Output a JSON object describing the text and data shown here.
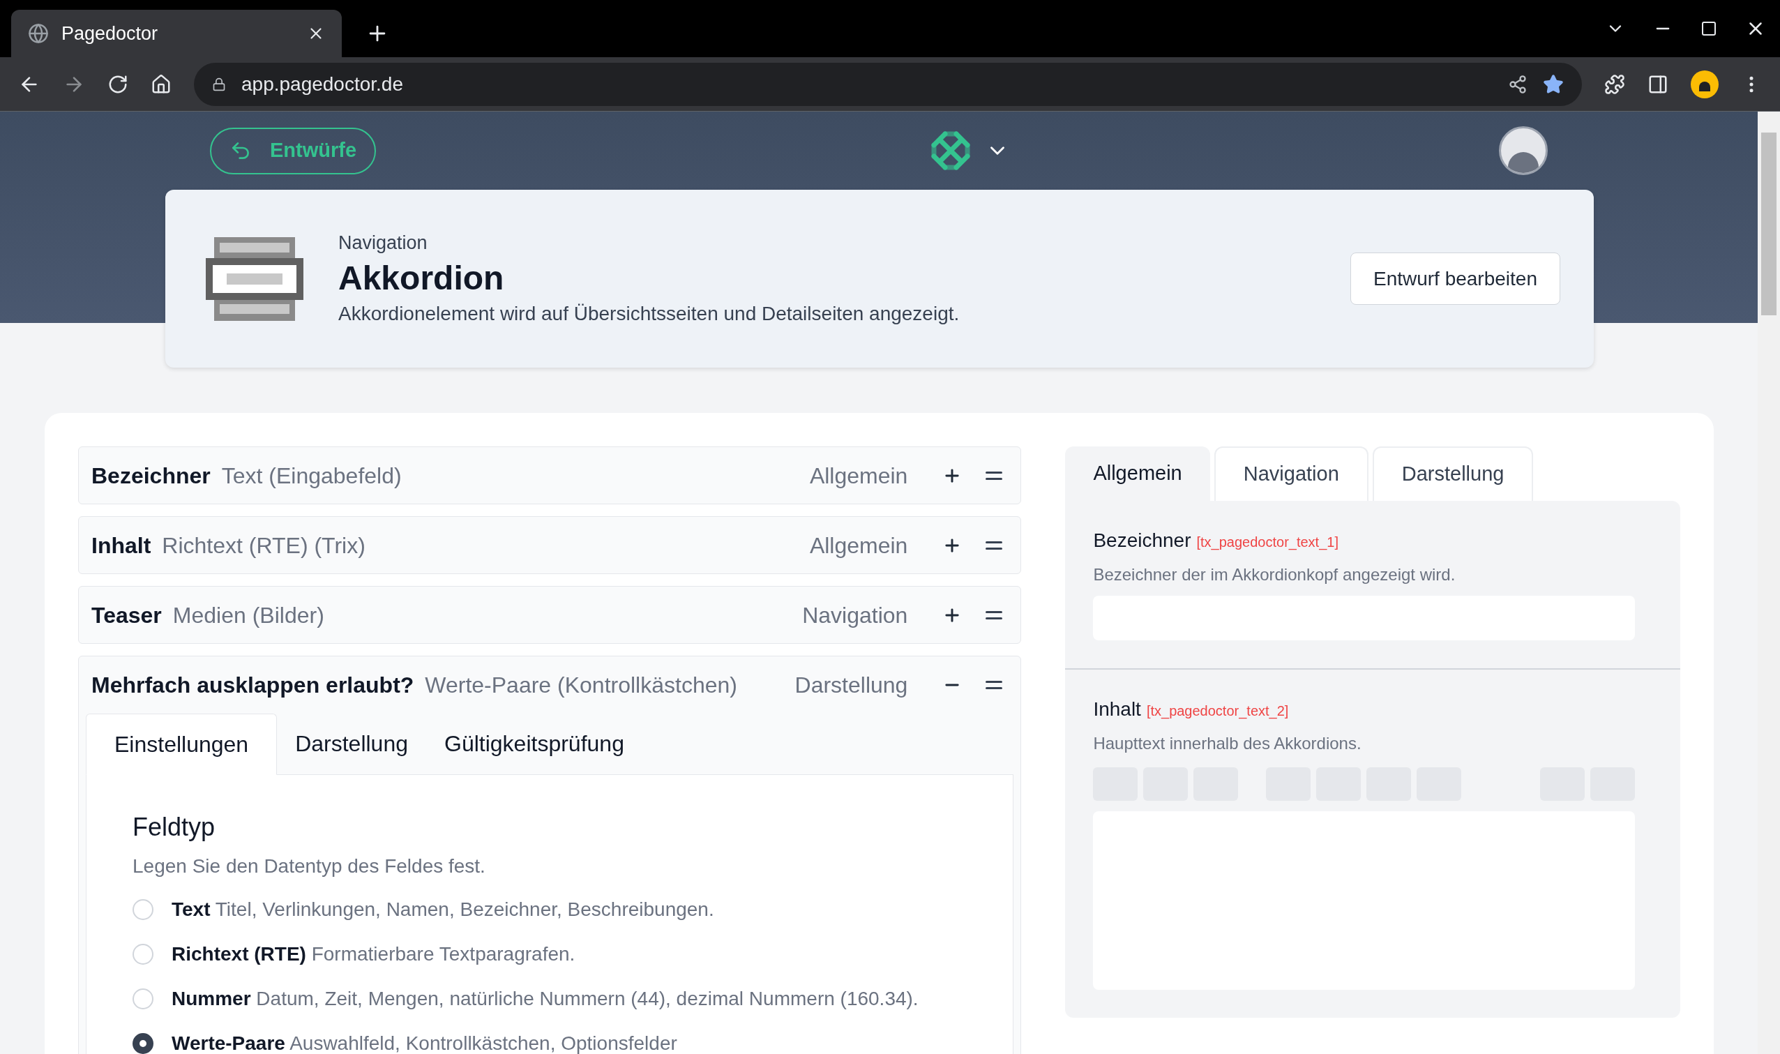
{
  "browser": {
    "tab_title": "Pagedoctor",
    "url": "app.pagedoctor.de"
  },
  "header": {
    "back_button": "Entwürfe"
  },
  "element_card": {
    "category": "Navigation",
    "title": "Akkordion",
    "description": "Akkordionelement wird auf Übersichtsseiten und Detailseiten angezeigt.",
    "edit_button": "Entwurf bearbeiten"
  },
  "fields": [
    {
      "name": "Bezeichner",
      "type": "Text (Eingabefeld)",
      "group": "Allgemein",
      "expanded": false
    },
    {
      "name": "Inhalt",
      "type": "Richtext (RTE) (Trix)",
      "group": "Allgemein",
      "expanded": false
    },
    {
      "name": "Teaser",
      "type": "Medien (Bilder)",
      "group": "Navigation",
      "expanded": false
    },
    {
      "name": "Mehrfach ausklappen erlaubt?",
      "type": "Werte-Paare (Kontrollkästchen)",
      "group": "Darstellung",
      "expanded": true
    }
  ],
  "field_editor": {
    "tabs": [
      {
        "label": "Einstellungen",
        "selected": true
      },
      {
        "label": "Darstellung",
        "selected": false
      },
      {
        "label": "Gültigkeitsprüfung",
        "selected": false
      }
    ],
    "section_title": "Feldtyp",
    "section_description": "Legen Sie den Datentyp des Feldes fest.",
    "options": [
      {
        "text": "**Text** Titel, Verlinkungen, Namen, Bezeichner, Beschreibungen.",
        "selected": false
      },
      {
        "text": "**Richtext (RTE)** Formatierbare Textparagrafen.",
        "selected": false
      },
      {
        "text": "**Nummer** Datum, Zeit, Mengen, natürliche Nummern (44), dezimal Nummern (160.34).",
        "selected": false
      },
      {
        "text": "**Werte-Paare** Auswahlfeld, Kontrollkästchen, Optionsfelder",
        "selected": true
      }
    ]
  },
  "preview": {
    "tabs": [
      {
        "label": "Allgemein",
        "selected": true
      },
      {
        "label": "Navigation",
        "selected": false
      },
      {
        "label": "Darstellung",
        "selected": false
      }
    ],
    "fields": [
      {
        "kind": "input",
        "label": "Bezeichner",
        "key": "[tx_pagedoctor_text_1]",
        "description": "Bezeichner der im Akkordionkopf angezeigt wird."
      },
      {
        "kind": "richtext",
        "label": "Inhalt",
        "key": "[tx_pagedoctor_text_2]",
        "description": "Haupttext innerhalb des Akkordions."
      }
    ]
  }
}
